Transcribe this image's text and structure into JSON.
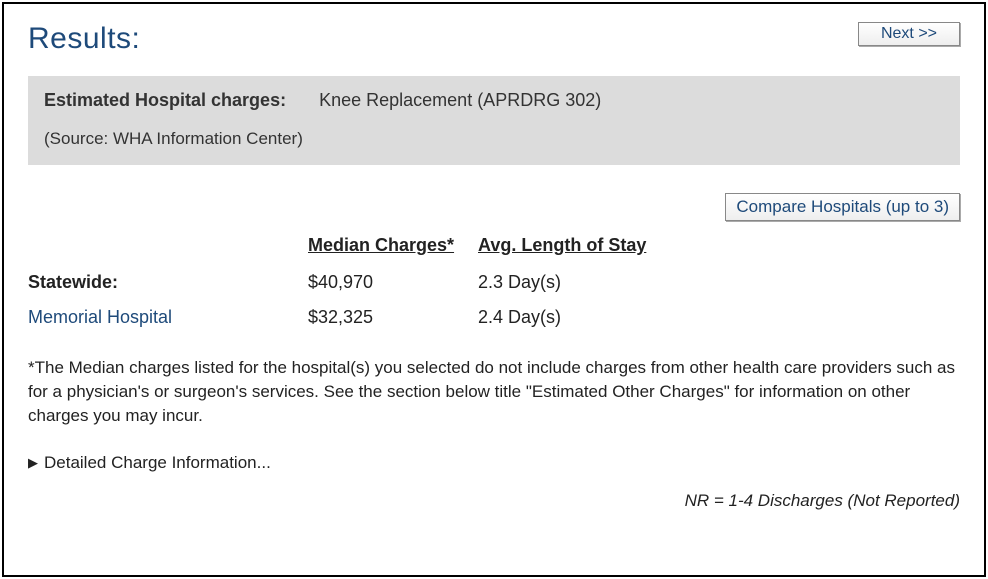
{
  "header": {
    "title": "Results:",
    "next_label": "Next >>"
  },
  "infobox": {
    "charges_label": "Estimated Hospital charges:",
    "procedure": "Knee Replacement (APRDRG 302)",
    "source": "(Source: WHA Information Center)"
  },
  "compare_label": "Compare Hospitals (up to 3)",
  "table": {
    "headers": {
      "median": "Median Charges*",
      "los": "Avg. Length of Stay"
    },
    "rows": [
      {
        "name": "Statewide:",
        "median": "$40,970",
        "los": "2.3 Day(s)",
        "link": false
      },
      {
        "name": "Memorial Hospital",
        "median": "$32,325",
        "los": "2.4 Day(s)",
        "link": true
      }
    ]
  },
  "footnote": "*The Median charges listed for the hospital(s) you selected do not include charges from other health care providers such as for a physician's or surgeon's services. See the section below title \"Estimated Other Charges\" for information on other charges you may incur.",
  "expander_label": "Detailed Charge Information...",
  "legend": "NR = 1-4 Discharges (Not Reported)"
}
